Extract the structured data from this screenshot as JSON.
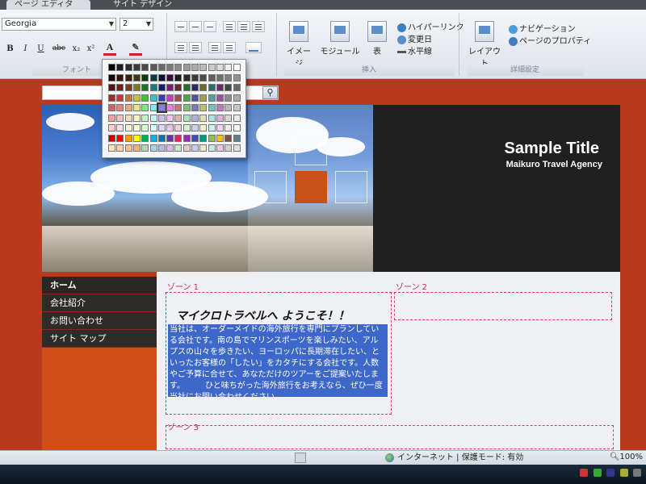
{
  "ribbon": {
    "tabs": [
      "ページ エディタ",
      "サイト デザイン"
    ],
    "font": {
      "family": "Georgia",
      "size": "2",
      "bold": "B",
      "italic": "I",
      "underline": "U",
      "strike": "abc",
      "subscript": "x₂",
      "superscript": "x²",
      "font_color": "A",
      "caption": "フォント"
    },
    "insert": {
      "image": "イメージ",
      "module": "モジュール",
      "table": "表",
      "hyperlink": "ハイパーリンク",
      "updated_date": "変更日",
      "horizontal_line": "水平線",
      "caption": "挿入"
    },
    "settings": {
      "layout": "レイアウト",
      "navigation": "ナビゲーション",
      "page_properties": "ページのプロパティ",
      "caption": "詳細設定"
    }
  },
  "palette": {
    "colors": [
      [
        "#000000",
        "#1f1f1f",
        "#2e2e2e",
        "#3a3a3a",
        "#4a4a4a",
        "#5a5a5a",
        "#6a6a6a",
        "#7a7a7a",
        "#8a8a8a",
        "#9a9a9a",
        "#aaaaaa",
        "#bbbbbb",
        "#cccccc",
        "#dddddd",
        "#eeeeee",
        "#ffffff"
      ],
      [
        "#200000",
        "#3b0d0d",
        "#3b1f0d",
        "#3b3b0d",
        "#0d3b0d",
        "#0d3b3b",
        "#0d0d3b",
        "#3b0d3b",
        "#1a1a1a",
        "#2b2b2b",
        "#3c3c3c",
        "#4d4d4d",
        "#5e5e5e",
        "#6f6f6f",
        "#808080",
        "#919191"
      ],
      [
        "#5a1010",
        "#7a1a1a",
        "#7a3d1a",
        "#7a7a1a",
        "#1a7a1a",
        "#1a7a7a",
        "#1a1a7a",
        "#7a1a7a",
        "#6b2a2a",
        "#2a6b2a",
        "#2a2a6b",
        "#6b6b2a",
        "#2a6b6b",
        "#6b2a6b",
        "#454545",
        "#676767"
      ],
      [
        "#9e2c2c",
        "#c43a3a",
        "#c4773a",
        "#c4c43a",
        "#3ac43a",
        "#3ac4c4",
        "#3a3ac4",
        "#c43ac4",
        "#a05050",
        "#50a050",
        "#5050a0",
        "#a0a050",
        "#50a0a0",
        "#a050a0",
        "#8c8c8c",
        "#a9a9a9"
      ],
      [
        "#d46060",
        "#e88080",
        "#e8a880",
        "#e8e880",
        "#80e880",
        "#80e8e8",
        "#8080e8",
        "#e880e8",
        "#c07878",
        "#78c078",
        "#7878c0",
        "#c0c078",
        "#78c0c0",
        "#c078c0",
        "#b8b8b8",
        "#c7c7c7"
      ],
      [
        "#f0a0a0",
        "#f5c0c0",
        "#f5d8c0",
        "#f5f5c0",
        "#c0f5c0",
        "#c0f5f5",
        "#c0c0f5",
        "#f5c0f5",
        "#e0b0b0",
        "#b0e0b0",
        "#b0b0e0",
        "#e0e0b0",
        "#b0e0e0",
        "#e0b0e0",
        "#d8d8d8",
        "#e8e8e8"
      ],
      [
        "#ffd0d0",
        "#ffe0e0",
        "#ffeed8",
        "#ffffd8",
        "#d8ffd8",
        "#d8ffff",
        "#d8d8ff",
        "#ffd8ff",
        "#f0d0d0",
        "#d0f0d0",
        "#d0d0f0",
        "#f0f0d0",
        "#d0f0f0",
        "#f0d0f0",
        "#ececec",
        "#f7f7f7"
      ],
      [
        "#c00000",
        "#ff0000",
        "#ff9900",
        "#ffff00",
        "#00b050",
        "#00b0f0",
        "#0070c0",
        "#7030a0",
        "#e91e63",
        "#9c27b0",
        "#3f51b5",
        "#009688",
        "#8bc34a",
        "#ffc107",
        "#795548",
        "#607d8b"
      ],
      [
        "#ffe0c0",
        "#ffd0a8",
        "#f8c090",
        "#f0b080",
        "#b0d8b0",
        "#a8d0e8",
        "#b8b8e8",
        "#e0b8e8",
        "#c8e8c8",
        "#e8c8c8",
        "#c8c8e8",
        "#e8e8c8",
        "#c8e8e8",
        "#e8c8e8",
        "#d0d0d0",
        "#e0e0e0"
      ]
    ],
    "selected": "4-6"
  },
  "site": {
    "title": "Sample Title",
    "subtitle": "Maikuro Travel Agency",
    "nav": [
      "ホーム",
      "会社紹介",
      "お問い合わせ",
      "サイト マップ"
    ],
    "zone1": "ゾーン 1",
    "zone2": "ゾーン 2",
    "zone3": "ゾーン 3",
    "welcome": "マイクロトラベルへ ようこそ！！",
    "intro": "当社は、オーダーメイドの海外旅行を専門にプランしている会社です。南の島でマリンスポーツを楽しみたい、アルプスの山々を歩きたい、ヨーロッパに長期滞在したい、といったお客様の「したい」をカタチにする会社です。人数やご予算に合せて、あなただけのツアーをご提案いたします。　　　ひと味ちがった海外旅行をお考えなら、ぜひ一度当社にお問い合わせください。"
  },
  "statusbar": {
    "zone_text": "インターネット | 保護モード: 有効",
    "zoom": "100%"
  }
}
